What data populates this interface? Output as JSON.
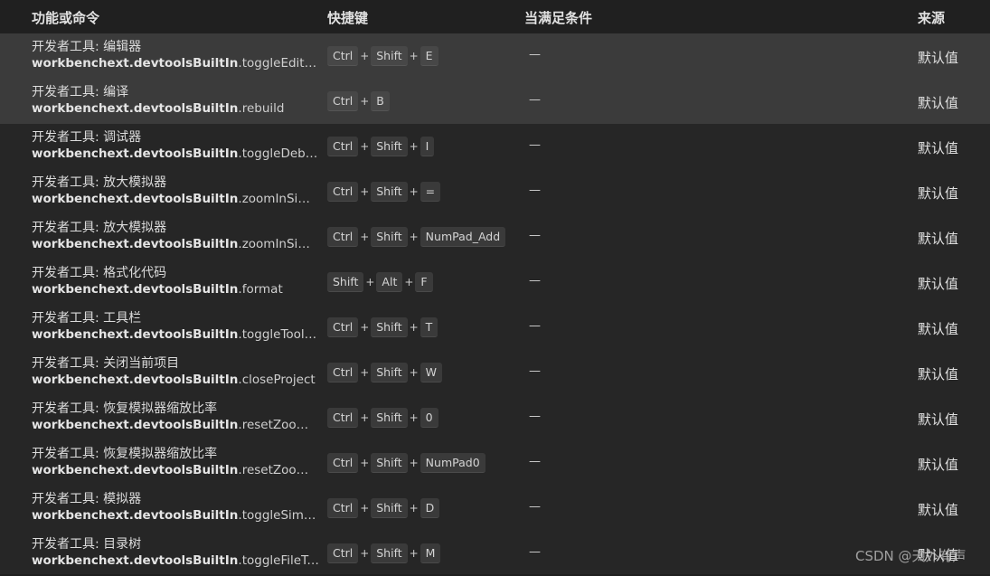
{
  "header": {
    "function": "功能或命令",
    "keybinding": "快捷键",
    "when": "当满足条件",
    "source": "来源"
  },
  "rows": [
    {
      "title": "开发者工具: 编辑器",
      "cmd_prefix": "workbenchext.devtoolsBuiltIn",
      "cmd_suffix": ".toggleEditorWi...",
      "keys": [
        "Ctrl",
        "Shift",
        "E"
      ],
      "when": "—",
      "source": "默认值",
      "selected": true
    },
    {
      "title": "开发者工具: 编译",
      "cmd_prefix": "workbenchext.devtoolsBuiltIn",
      "cmd_suffix": ".rebuild",
      "keys": [
        "Ctrl",
        "B"
      ],
      "when": "—",
      "source": "默认值",
      "selected": true
    },
    {
      "title": "开发者工具: 调试器",
      "cmd_prefix": "workbenchext.devtoolsBuiltIn",
      "cmd_suffix": ".toggleDebug...",
      "keys": [
        "Ctrl",
        "Shift",
        "I"
      ],
      "when": "—",
      "source": "默认值",
      "selected": false
    },
    {
      "title": "开发者工具: 放大模拟器",
      "cmd_prefix": "workbenchext.devtoolsBuiltIn",
      "cmd_suffix": ".zoomInSimulat...",
      "keys": [
        "Ctrl",
        "Shift",
        "="
      ],
      "when": "—",
      "source": "默认值",
      "selected": false
    },
    {
      "title": "开发者工具: 放大模拟器",
      "cmd_prefix": "workbenchext.devtoolsBuiltIn",
      "cmd_suffix": ".zoomInSimulat...",
      "keys": [
        "Ctrl",
        "Shift",
        "NumPad_Add"
      ],
      "when": "—",
      "source": "默认值",
      "selected": false
    },
    {
      "title": "开发者工具: 格式化代码",
      "cmd_prefix": "workbenchext.devtoolsBuiltIn",
      "cmd_suffix": ".format",
      "keys": [
        "Shift",
        "Alt",
        "F"
      ],
      "when": "—",
      "source": "默认值",
      "selected": false
    },
    {
      "title": "开发者工具: 工具栏",
      "cmd_prefix": "workbenchext.devtoolsBuiltIn",
      "cmd_suffix": ".toggleToolbar",
      "keys": [
        "Ctrl",
        "Shift",
        "T"
      ],
      "when": "—",
      "source": "默认值",
      "selected": false
    },
    {
      "title": "开发者工具: 关闭当前项目",
      "cmd_prefix": "workbenchext.devtoolsBuiltIn",
      "cmd_suffix": ".closeProject",
      "keys": [
        "Ctrl",
        "Shift",
        "W"
      ],
      "when": "—",
      "source": "默认值",
      "selected": false
    },
    {
      "title": "开发者工具: 恢复模拟器缩放比率",
      "cmd_prefix": "workbenchext.devtoolsBuiltIn",
      "cmd_suffix": ".resetZoomSim...",
      "keys": [
        "Ctrl",
        "Shift",
        "0"
      ],
      "when": "—",
      "source": "默认值",
      "selected": false
    },
    {
      "title": "开发者工具: 恢复模拟器缩放比率",
      "cmd_prefix": "workbenchext.devtoolsBuiltIn",
      "cmd_suffix": ".resetZoomSim...",
      "keys": [
        "Ctrl",
        "Shift",
        "NumPad0"
      ],
      "when": "—",
      "source": "默认值",
      "selected": false
    },
    {
      "title": "开发者工具: 模拟器",
      "cmd_prefix": "workbenchext.devtoolsBuiltIn",
      "cmd_suffix": ".toggleSimulato...",
      "keys": [
        "Ctrl",
        "Shift",
        "D"
      ],
      "when": "—",
      "source": "默认值",
      "selected": false
    },
    {
      "title": "开发者工具: 目录树",
      "cmd_prefix": "workbenchext.devtoolsBuiltIn",
      "cmd_suffix": ".toggleFileTree",
      "keys": [
        "Ctrl",
        "Shift",
        "M"
      ],
      "when": "—",
      "source": "默认值",
      "selected": false
    }
  ],
  "key_separator": "+",
  "watermark": "CSDN @天外有声"
}
